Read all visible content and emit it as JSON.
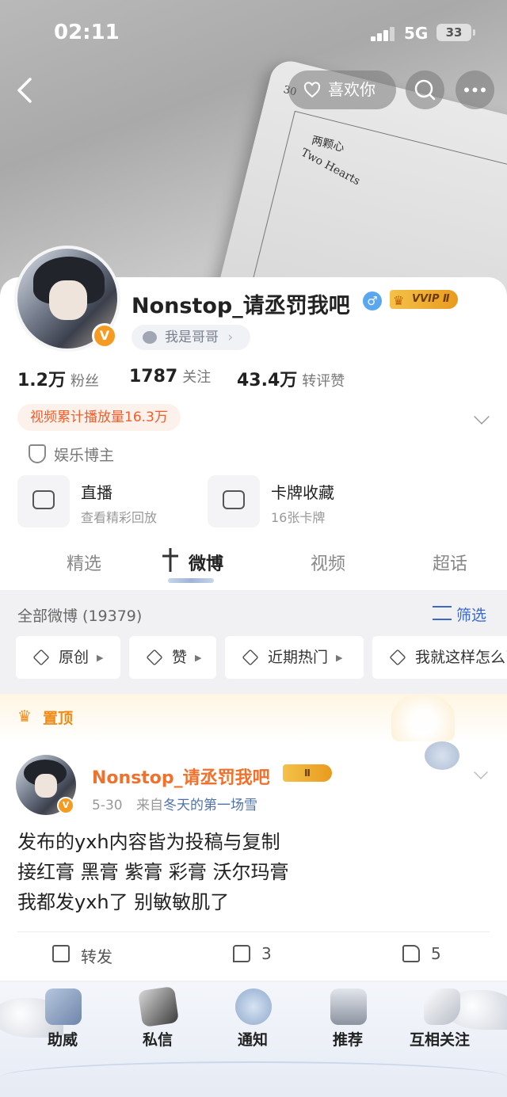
{
  "status_bar": {
    "time": "02:11",
    "network": "5G",
    "battery": "33"
  },
  "header": {
    "like_label": "喜欢你",
    "banner_card": {
      "number": "30",
      "title": "两颗心",
      "subtitle": "Two Hearts"
    }
  },
  "profile": {
    "name": "Nonstop_请丞罚我吧",
    "vip_label": "VVIP Ⅱ",
    "gender_symbol": "♂",
    "verify_symbol": "V",
    "tagline": "我是哥哥",
    "stats": [
      {
        "value": "1.2万",
        "label": "粉丝"
      },
      {
        "value": "1787",
        "label": "关注"
      },
      {
        "value": "43.4万",
        "label": "转评赞"
      }
    ],
    "play_count": "视频累计播放量16.3万",
    "category": "娱乐博主",
    "services": [
      {
        "title": "直播",
        "subtitle": "查看精彩回放"
      },
      {
        "title": "卡牌收藏",
        "subtitle": "16张卡牌"
      }
    ]
  },
  "tabs": [
    {
      "label": "精选",
      "active": false
    },
    {
      "label": "微博",
      "active": true
    },
    {
      "label": "视频",
      "active": false
    },
    {
      "label": "超话",
      "active": false
    }
  ],
  "feed_header": {
    "count_label": "全部微博 (19379)",
    "filter_label": "筛选",
    "chips": [
      "原创",
      "赞",
      "近期热门",
      "我就这样怎么了"
    ]
  },
  "post": {
    "pinned_label": "置顶",
    "author": "Nonstop_请丞罚我吧",
    "vip_badge": "Ⅱ",
    "date": "5-30",
    "source_prefix": "来自",
    "source": "冬天的第一场雪",
    "lines": [
      "发布的yxh内容皆为投稿与复制",
      "接红膏 黑膏 紫膏 彩膏 沃尔玛膏",
      "我都发yxh了 别敏敏肌了"
    ],
    "repost_label": "转发",
    "comment_count": "3",
    "like_count": "5"
  },
  "bottom_nav": {
    "items": [
      "助威",
      "私信",
      "通知",
      "推荐",
      "互相关注"
    ]
  },
  "colors": {
    "accent_orange": "#f0712c",
    "link_blue": "#3a69c8",
    "vip_gold": "#f4c24a",
    "play_badge_text": "#f25d2a"
  }
}
